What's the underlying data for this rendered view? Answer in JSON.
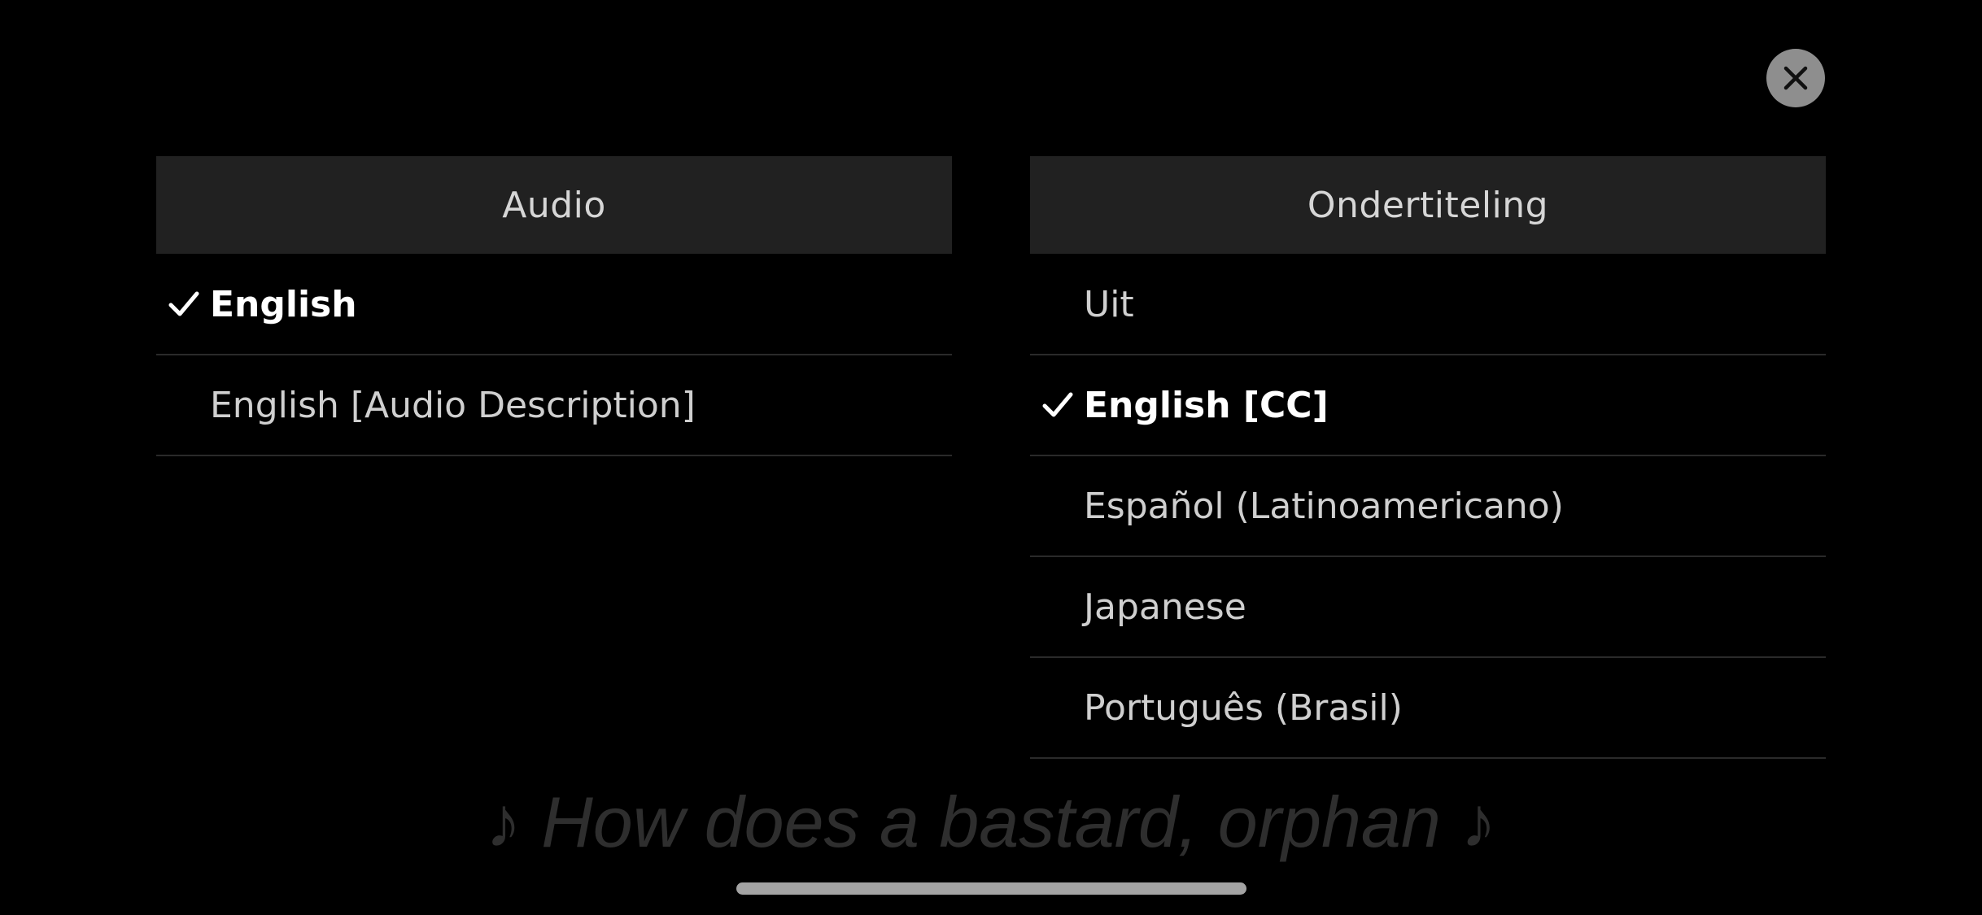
{
  "close": {
    "icon": "close-icon"
  },
  "audio": {
    "header": "Audio",
    "options": [
      {
        "label": "English",
        "selected": true
      },
      {
        "label": "English [Audio Description]",
        "selected": false
      }
    ]
  },
  "subtitles": {
    "header": "Ondertiteling",
    "options": [
      {
        "label": "Uit",
        "selected": false
      },
      {
        "label": "English [CC]",
        "selected": true
      },
      {
        "label": "Español (Latinoamericano)",
        "selected": false
      },
      {
        "label": "Japanese",
        "selected": false
      },
      {
        "label": "Português (Brasil)",
        "selected": false
      }
    ]
  },
  "caption": "♪ How does a bastard, orphan ♪",
  "colors": {
    "background": "#000000",
    "header_bg": "#212121",
    "close_button": "#8e8e8e",
    "selected_text": "#ffffff",
    "option_text": "#cfcfcf",
    "caption_text": "#2e2e2e"
  }
}
